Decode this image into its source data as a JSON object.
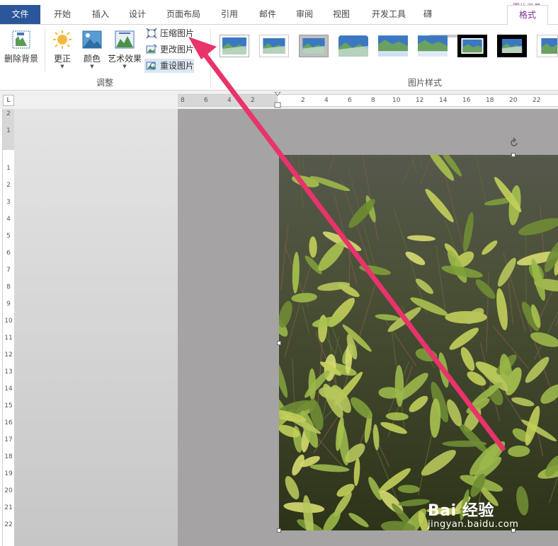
{
  "ribbon_tabs": [
    "文件",
    "开始",
    "插入",
    "设计",
    "页面布局",
    "引用",
    "邮件",
    "审阅",
    "视图",
    "开发工具",
    "格式"
  ],
  "context_tab_group": "图片工具",
  "adjust_group": {
    "label": "调整",
    "remove_background": "删除背景",
    "corrections": "更正",
    "color": "颜色",
    "artistic_effects": "艺术效果",
    "compress_pictures": "压缩图片",
    "change_picture": "更改图片",
    "reset_picture": "重设图片"
  },
  "picture_styles_group": {
    "label": "图片样式"
  },
  "horizontal_ruler": [
    "8",
    "6",
    "4",
    "2",
    "2",
    "4",
    "6",
    "8",
    "10",
    "12",
    "14",
    "16",
    "18",
    "20",
    "22"
  ],
  "vertical_ruler": [
    "2",
    "1",
    "1",
    "2",
    "3",
    "4",
    "5",
    "6",
    "7",
    "8",
    "9",
    "10",
    "11",
    "12",
    "13",
    "14",
    "15",
    "16",
    "17",
    "18",
    "19",
    "20",
    "21",
    "22"
  ],
  "watermark": {
    "brand": "Bai 经验",
    "url": "jingyan.baidu.com"
  },
  "annotation_arrow_color": "#e8336b",
  "accent_color": "#2b579a",
  "context_color": "#a646a6"
}
